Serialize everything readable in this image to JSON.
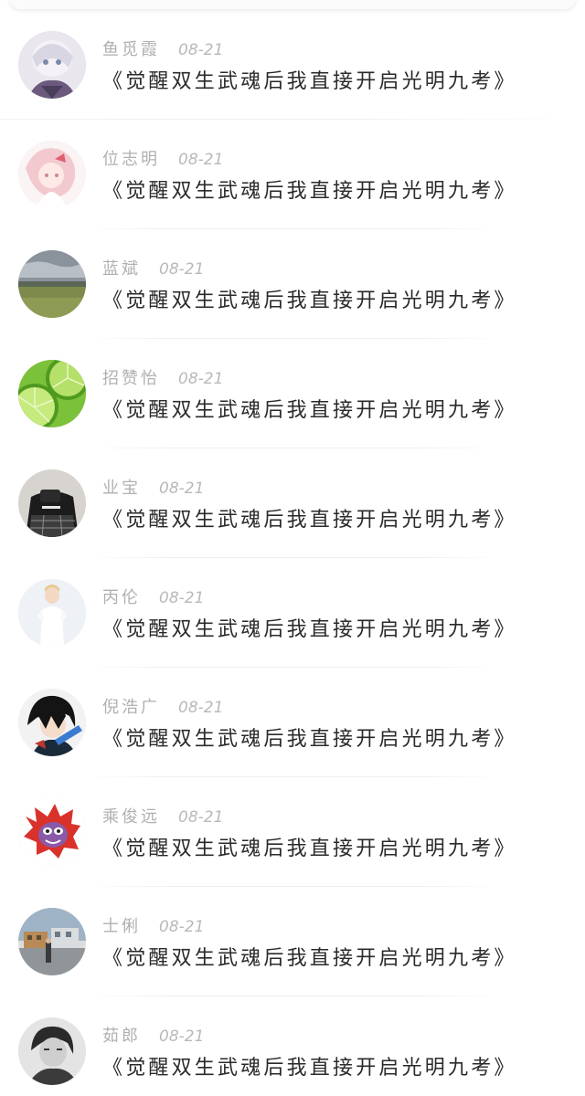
{
  "feed": {
    "items": [
      {
        "name": "鱼觅霞",
        "date": "08-21",
        "title": "《觉醒双生武魂后我直接开启光明九考》",
        "avatar_icon": "anime-white-hair-avatar-icon"
      },
      {
        "name": "位志明",
        "date": "08-21",
        "title": "《觉醒双生武魂后我直接开启光明九考》",
        "avatar_icon": "pink-anime-girl-avatar-icon"
      },
      {
        "name": "蓝斌",
        "date": "08-21",
        "title": "《觉醒双生武魂后我直接开启光明九考》",
        "avatar_icon": "grassland-landscape-avatar-icon"
      },
      {
        "name": "招赞怡",
        "date": "08-21",
        "title": "《觉醒双生武魂后我直接开启光明九考》",
        "avatar_icon": "lime-slices-avatar-icon"
      },
      {
        "name": "业宝",
        "date": "08-21",
        "title": "《觉醒双生武魂后我直接开启光明九考》",
        "avatar_icon": "black-shirt-person-avatar-icon"
      },
      {
        "name": "丙伦",
        "date": "08-21",
        "title": "《觉醒双生武魂后我直接开启光明九考》",
        "avatar_icon": "child-white-dress-avatar-icon"
      },
      {
        "name": "倪浩广",
        "date": "08-21",
        "title": "《觉醒双生武魂后我直接开启光明九考》",
        "avatar_icon": "anime-dark-hair-avatar-icon"
      },
      {
        "name": "乘俊远",
        "date": "08-21",
        "title": "《觉醒双生武魂后我直接开启光明九考》",
        "avatar_icon": "cartoon-mascot-avatar-icon"
      },
      {
        "name": "士俐",
        "date": "08-21",
        "title": "《觉醒双生武魂后我直接开启光明九考》",
        "avatar_icon": "street-scene-avatar-icon"
      },
      {
        "name": "茹郎",
        "date": "08-21",
        "title": "《觉醒双生武魂后我直接开启光明九考》",
        "avatar_icon": "bw-portrait-avatar-icon"
      }
    ]
  }
}
